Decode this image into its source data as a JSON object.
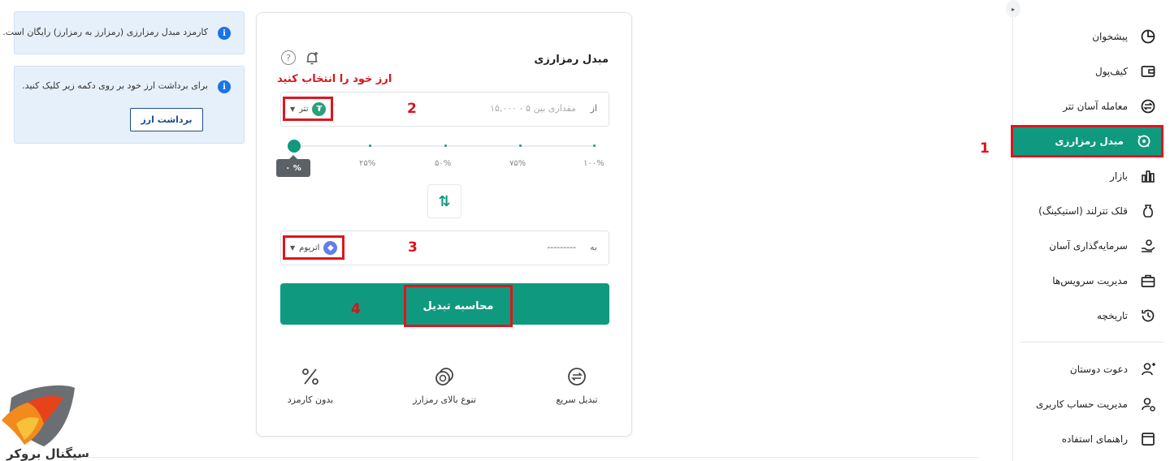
{
  "sidebar": {
    "items": [
      {
        "label": "پیشخوان",
        "icon": "dashboard-pie-icon"
      },
      {
        "label": "کیف‌پول",
        "icon": "wallet-icon"
      },
      {
        "label": "معامله آسان تتر",
        "icon": "exchange-icon"
      },
      {
        "label": "مبدل رمزارزی",
        "icon": "crypto-convert-icon",
        "active": true
      },
      {
        "label": "بازار",
        "icon": "market-chart-icon"
      },
      {
        "label": "قلک تترلند (استیکینگ)",
        "icon": "piggy-bank-icon"
      },
      {
        "label": "سرمایه‌گذاری آسان",
        "icon": "invest-hand-icon"
      },
      {
        "label": "مدیریت سرویس‌ها",
        "icon": "briefcase-icon"
      },
      {
        "label": "تاریخچه",
        "icon": "history-icon"
      },
      {
        "label": "دعوت دوستان",
        "icon": "add-user-icon"
      },
      {
        "label": "مدیریت حساب کاربری",
        "icon": "user-settings-icon"
      },
      {
        "label": "راهنمای استفاده",
        "icon": "guide-icon"
      }
    ]
  },
  "annotations": {
    "n1": "1",
    "n2": "2",
    "n3": "3",
    "n4": "4"
  },
  "converter": {
    "title": "مبدل رمزارزی",
    "instruction": "ارز خود را انتخاب کنید",
    "from_prefix": "از",
    "from_placeholder": "مقداری بین ۵ - ۱۵,۰۰۰",
    "from_currency": "تتر",
    "to_prefix": "به",
    "to_value": "---------",
    "to_currency": "اتریوم",
    "slider_value": "۰ %",
    "slider_percent": 0,
    "slider_ticks": [
      "۲۵%",
      "۵۰%",
      "۷۵%",
      "۱۰۰%"
    ],
    "calc_button": "محاسبه تبدیل",
    "features": [
      {
        "label": "تبدیل سریع",
        "icon": "fast-exchange-icon"
      },
      {
        "label": "تنوع بالای رمزارز",
        "icon": "coins-icon"
      },
      {
        "label": "بدون کارمزد",
        "icon": "percent-icon"
      }
    ]
  },
  "info": {
    "fee_text": "کارمزد مبدل رمزارزی (رمزارز به رمزارز) رایگان است.",
    "withdraw_text": "برای برداشت ارز خود بر روی دکمه زیر کلیک کنید.",
    "withdraw_button": "برداشت ارز"
  },
  "logo": {
    "text": "سیگنال بروکر"
  },
  "colors": {
    "accent": "#0f9a80",
    "annotation": "#e0151d",
    "info_bg": "#e6f0fb",
    "info_icon": "#1a73e8"
  }
}
